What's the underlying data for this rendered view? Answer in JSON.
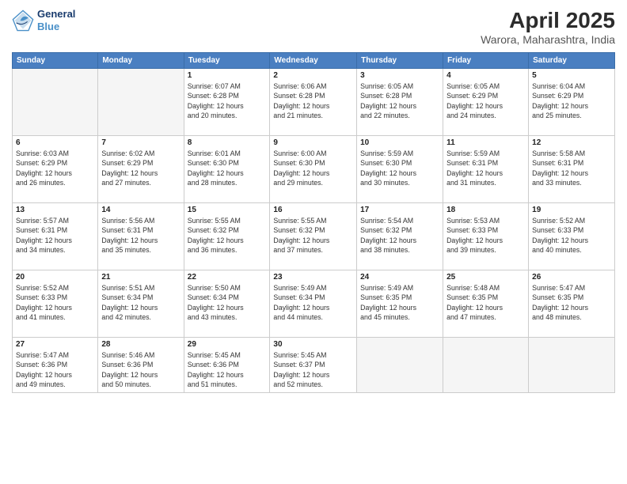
{
  "header": {
    "logo_line1": "General",
    "logo_line2": "Blue",
    "month": "April 2025",
    "location": "Warora, Maharashtra, India"
  },
  "weekdays": [
    "Sunday",
    "Monday",
    "Tuesday",
    "Wednesday",
    "Thursday",
    "Friday",
    "Saturday"
  ],
  "weeks": [
    [
      {
        "day": "",
        "info": ""
      },
      {
        "day": "",
        "info": ""
      },
      {
        "day": "1",
        "info": "Sunrise: 6:07 AM\nSunset: 6:28 PM\nDaylight: 12 hours\nand 20 minutes."
      },
      {
        "day": "2",
        "info": "Sunrise: 6:06 AM\nSunset: 6:28 PM\nDaylight: 12 hours\nand 21 minutes."
      },
      {
        "day": "3",
        "info": "Sunrise: 6:05 AM\nSunset: 6:28 PM\nDaylight: 12 hours\nand 22 minutes."
      },
      {
        "day": "4",
        "info": "Sunrise: 6:05 AM\nSunset: 6:29 PM\nDaylight: 12 hours\nand 24 minutes."
      },
      {
        "day": "5",
        "info": "Sunrise: 6:04 AM\nSunset: 6:29 PM\nDaylight: 12 hours\nand 25 minutes."
      }
    ],
    [
      {
        "day": "6",
        "info": "Sunrise: 6:03 AM\nSunset: 6:29 PM\nDaylight: 12 hours\nand 26 minutes."
      },
      {
        "day": "7",
        "info": "Sunrise: 6:02 AM\nSunset: 6:29 PM\nDaylight: 12 hours\nand 27 minutes."
      },
      {
        "day": "8",
        "info": "Sunrise: 6:01 AM\nSunset: 6:30 PM\nDaylight: 12 hours\nand 28 minutes."
      },
      {
        "day": "9",
        "info": "Sunrise: 6:00 AM\nSunset: 6:30 PM\nDaylight: 12 hours\nand 29 minutes."
      },
      {
        "day": "10",
        "info": "Sunrise: 5:59 AM\nSunset: 6:30 PM\nDaylight: 12 hours\nand 30 minutes."
      },
      {
        "day": "11",
        "info": "Sunrise: 5:59 AM\nSunset: 6:31 PM\nDaylight: 12 hours\nand 31 minutes."
      },
      {
        "day": "12",
        "info": "Sunrise: 5:58 AM\nSunset: 6:31 PM\nDaylight: 12 hours\nand 33 minutes."
      }
    ],
    [
      {
        "day": "13",
        "info": "Sunrise: 5:57 AM\nSunset: 6:31 PM\nDaylight: 12 hours\nand 34 minutes."
      },
      {
        "day": "14",
        "info": "Sunrise: 5:56 AM\nSunset: 6:31 PM\nDaylight: 12 hours\nand 35 minutes."
      },
      {
        "day": "15",
        "info": "Sunrise: 5:55 AM\nSunset: 6:32 PM\nDaylight: 12 hours\nand 36 minutes."
      },
      {
        "day": "16",
        "info": "Sunrise: 5:55 AM\nSunset: 6:32 PM\nDaylight: 12 hours\nand 37 minutes."
      },
      {
        "day": "17",
        "info": "Sunrise: 5:54 AM\nSunset: 6:32 PM\nDaylight: 12 hours\nand 38 minutes."
      },
      {
        "day": "18",
        "info": "Sunrise: 5:53 AM\nSunset: 6:33 PM\nDaylight: 12 hours\nand 39 minutes."
      },
      {
        "day": "19",
        "info": "Sunrise: 5:52 AM\nSunset: 6:33 PM\nDaylight: 12 hours\nand 40 minutes."
      }
    ],
    [
      {
        "day": "20",
        "info": "Sunrise: 5:52 AM\nSunset: 6:33 PM\nDaylight: 12 hours\nand 41 minutes."
      },
      {
        "day": "21",
        "info": "Sunrise: 5:51 AM\nSunset: 6:34 PM\nDaylight: 12 hours\nand 42 minutes."
      },
      {
        "day": "22",
        "info": "Sunrise: 5:50 AM\nSunset: 6:34 PM\nDaylight: 12 hours\nand 43 minutes."
      },
      {
        "day": "23",
        "info": "Sunrise: 5:49 AM\nSunset: 6:34 PM\nDaylight: 12 hours\nand 44 minutes."
      },
      {
        "day": "24",
        "info": "Sunrise: 5:49 AM\nSunset: 6:35 PM\nDaylight: 12 hours\nand 45 minutes."
      },
      {
        "day": "25",
        "info": "Sunrise: 5:48 AM\nSunset: 6:35 PM\nDaylight: 12 hours\nand 47 minutes."
      },
      {
        "day": "26",
        "info": "Sunrise: 5:47 AM\nSunset: 6:35 PM\nDaylight: 12 hours\nand 48 minutes."
      }
    ],
    [
      {
        "day": "27",
        "info": "Sunrise: 5:47 AM\nSunset: 6:36 PM\nDaylight: 12 hours\nand 49 minutes."
      },
      {
        "day": "28",
        "info": "Sunrise: 5:46 AM\nSunset: 6:36 PM\nDaylight: 12 hours\nand 50 minutes."
      },
      {
        "day": "29",
        "info": "Sunrise: 5:45 AM\nSunset: 6:36 PM\nDaylight: 12 hours\nand 51 minutes."
      },
      {
        "day": "30",
        "info": "Sunrise: 5:45 AM\nSunset: 6:37 PM\nDaylight: 12 hours\nand 52 minutes."
      },
      {
        "day": "",
        "info": ""
      },
      {
        "day": "",
        "info": ""
      },
      {
        "day": "",
        "info": ""
      }
    ]
  ]
}
